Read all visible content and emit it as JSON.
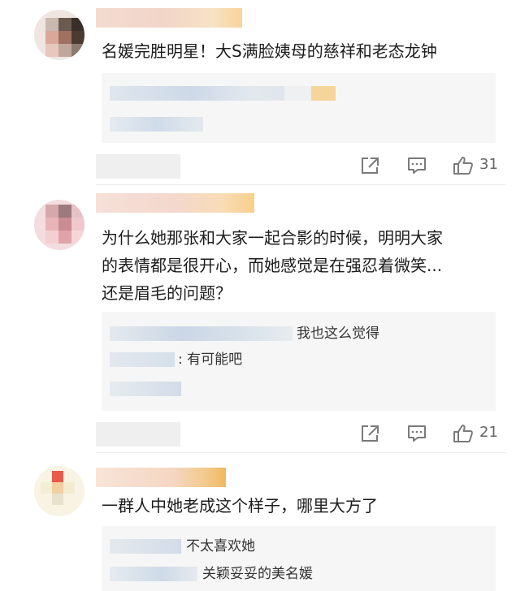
{
  "comments": [
    {
      "text": "名媛完胜明星！大S满脸姨母的慈祥和老态龙钟",
      "replies": [],
      "likes": "31"
    },
    {
      "text": "为什么她那张和大家一起合影的时候，明明大家\n的表情都是很开心，而她感觉是在强忍着微笑...\n还是眉毛的问题？",
      "replies": [
        "我也这么觉得",
        ": 有可能吧"
      ],
      "likes": "21"
    },
    {
      "text": "一群人中她老成这个样子，哪里大方了",
      "replies": [
        "不太喜欢她",
        "关颖妥妥的美名媛"
      ],
      "likes": ""
    }
  ],
  "icons": {
    "share": "share-icon",
    "comment": "comment-icon",
    "like": "thumbs-up-icon"
  },
  "colors": {
    "reply_bg": "#f6f6f6",
    "icon": "#7a7a7a",
    "blur_blue": "#cdd9e8",
    "blur_orange": "#f6c890"
  }
}
